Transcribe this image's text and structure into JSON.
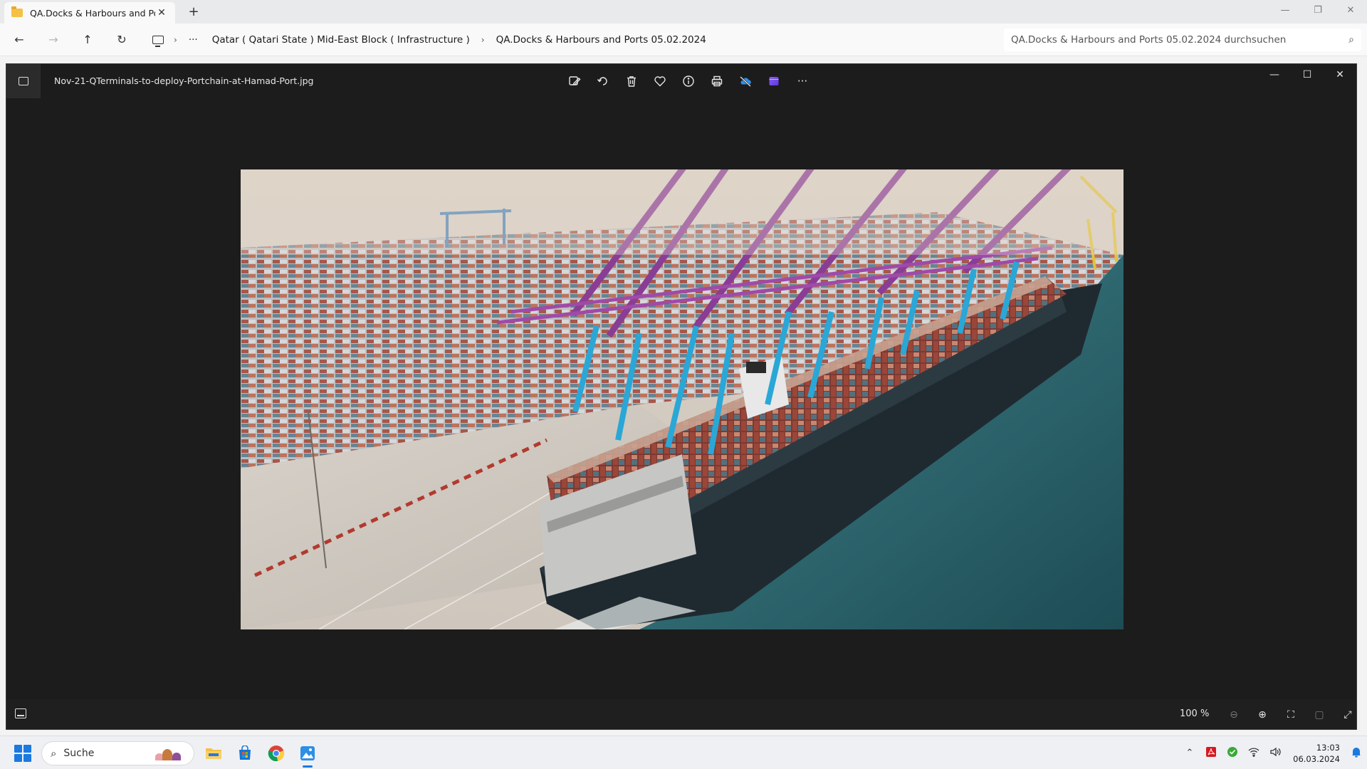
{
  "explorer": {
    "tab_title": "QA.Docks & Harbours and Por",
    "tab_close": "✕",
    "new_tab": "+",
    "window_controls": {
      "minimize": "—",
      "restore": "❐",
      "close": "✕"
    },
    "nav": {
      "back": "←",
      "forward": "→",
      "up": "↑",
      "refresh": "↻"
    },
    "breadcrumb": {
      "more": "···",
      "items": [
        "Qatar ( Qatari State ) Mid-East Block ( Infrastructure )",
        "QA.Docks & Harbours and Ports 05.02.2024"
      ],
      "separator": "›"
    },
    "search_placeholder": "QA.Docks & Harbours and Ports 05.02.2024 durchsuchen"
  },
  "photos": {
    "file_name": "Nov-21-QTerminals-to-deploy-Portchain-at-Hamad-Port.jpg",
    "toolbar_icons": [
      "edit-image-icon",
      "rotate-icon",
      "delete-icon",
      "favorite-icon",
      "info-icon",
      "print-icon",
      "onedrive-icon",
      "clipchamp-icon",
      "more-icon"
    ],
    "more_label": "···",
    "window_controls": {
      "minimize": "—",
      "maximize": "☐",
      "close": "✕"
    },
    "zoom_level": "100 %",
    "footer": {
      "zoom_out": "⊖",
      "zoom_in": "⊕",
      "fit": "⛶",
      "actual_size": "▢",
      "fullscreen": "⤢"
    }
  },
  "taskbar": {
    "search_label": "Suche",
    "time": "13:03",
    "date": "06.03.2024",
    "accent": "#1b79e0"
  }
}
